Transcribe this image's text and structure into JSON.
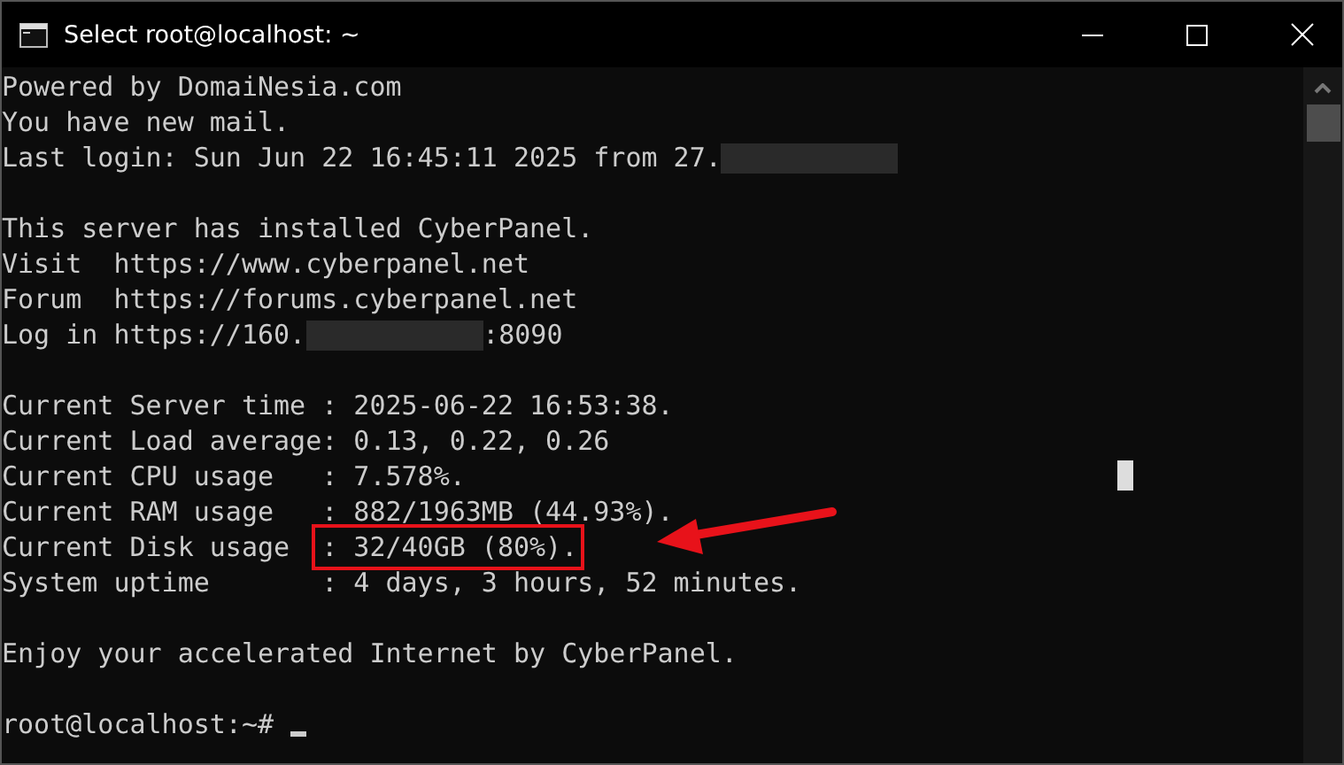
{
  "window": {
    "title": "Select root@localhost: ~"
  },
  "lines": [
    {
      "kind": "text",
      "parts": [
        {
          "kind": "plain",
          "text": "Powered by DomaiNesia.com"
        }
      ]
    },
    {
      "kind": "text",
      "parts": [
        {
          "kind": "plain",
          "text": "You have new mail."
        }
      ]
    },
    {
      "kind": "text",
      "parts": [
        {
          "kind": "plain",
          "text": "Last login: Sun Jun 22 16:45:11 2025 from 27."
        },
        {
          "kind": "redacted"
        }
      ]
    },
    {
      "kind": "blank"
    },
    {
      "kind": "text",
      "parts": [
        {
          "kind": "plain",
          "text": "This server has installed CyberPanel."
        }
      ]
    },
    {
      "kind": "text",
      "parts": [
        {
          "kind": "plain",
          "text": "Visit  https://www.cyberpanel.net"
        }
      ]
    },
    {
      "kind": "text",
      "parts": [
        {
          "kind": "plain",
          "text": "Forum  https://forums.cyberpanel.net"
        }
      ]
    },
    {
      "kind": "text",
      "parts": [
        {
          "kind": "plain",
          "text": "Log in https://160."
        },
        {
          "kind": "redacted"
        },
        {
          "kind": "plain",
          "text": ":8090"
        }
      ]
    },
    {
      "kind": "blank"
    },
    {
      "kind": "text",
      "parts": [
        {
          "kind": "plain",
          "text": "Current Server time : 2025-06-22 16:53:38."
        }
      ]
    },
    {
      "kind": "text",
      "parts": [
        {
          "kind": "plain",
          "text": "Current Load average: 0.13, 0.22, 0.26"
        }
      ]
    },
    {
      "kind": "text",
      "parts": [
        {
          "kind": "plain",
          "text": "Current CPU usage   : 7.578%."
        }
      ]
    },
    {
      "kind": "text",
      "parts": [
        {
          "kind": "plain",
          "text": "Current RAM usage   : 882/1963MB (44.93%)."
        }
      ]
    },
    {
      "kind": "text",
      "parts": [
        {
          "kind": "plain",
          "text": "Current Disk usage  "
        },
        {
          "kind": "boxed",
          "text": ": 32/40GB (80%)."
        }
      ]
    },
    {
      "kind": "text",
      "parts": [
        {
          "kind": "plain",
          "text": "System uptime       : 4 days, 3 hours, 52 minutes."
        }
      ]
    },
    {
      "kind": "blank"
    },
    {
      "kind": "text",
      "parts": [
        {
          "kind": "plain",
          "text": "Enjoy your accelerated Internet by CyberPanel."
        }
      ]
    },
    {
      "kind": "blank"
    },
    {
      "kind": "prompt",
      "parts": [
        {
          "kind": "plain",
          "text": "root@localhost:~# "
        }
      ]
    }
  ]
}
